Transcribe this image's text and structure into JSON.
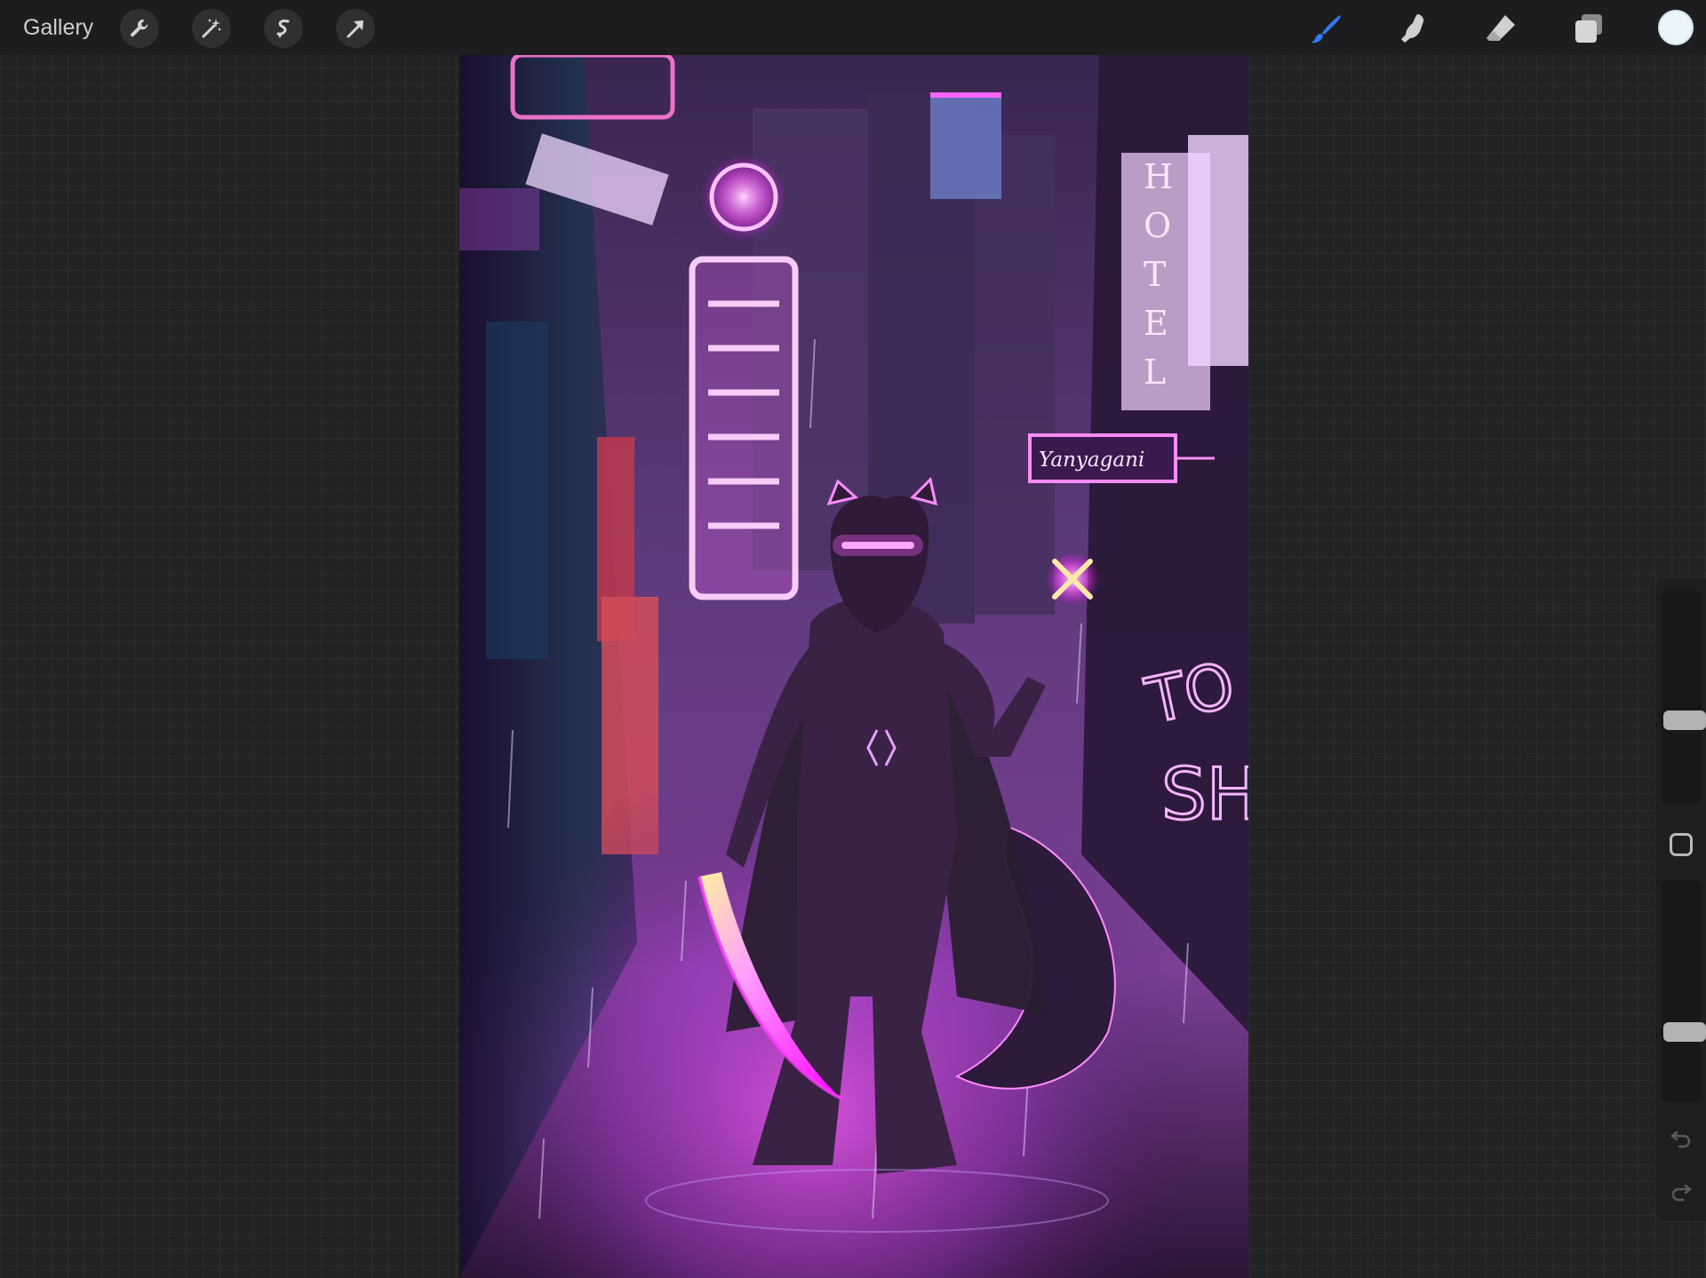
{
  "toolbar": {
    "gallery_label": "Gallery",
    "left_tools": [
      "wrench-icon",
      "magic-wand-icon",
      "selection-icon",
      "transform-arrow-icon"
    ],
    "right_tools": [
      "brush-icon",
      "smudge-icon",
      "eraser-icon",
      "layers-icon"
    ],
    "active_tool": "brush",
    "active_color": "#eaf6fa",
    "accent_color": "#2f7cf6"
  },
  "sidebar": {
    "brush_size_level": 0.38,
    "opacity_level": 0.3,
    "buttons": [
      "modify-square-icon",
      "undo-icon",
      "redo-icon"
    ]
  },
  "artwork": {
    "signs": {
      "hotel_vertical": [
        "H",
        "O",
        "T",
        "E",
        "L"
      ],
      "neon_script": "Yanyagani",
      "side_neon_top": "TO",
      "side_neon_bottom": "SH"
    }
  }
}
